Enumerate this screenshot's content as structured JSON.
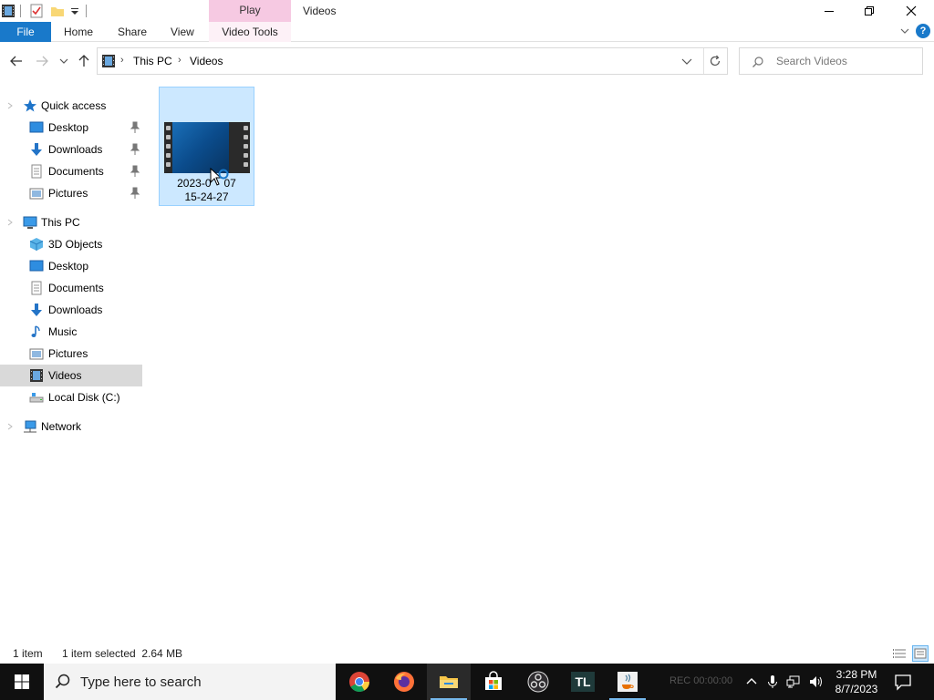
{
  "window": {
    "title": "Videos",
    "context_tab_group": "Play"
  },
  "ribbon": {
    "tabs": [
      {
        "label": "File"
      },
      {
        "label": "Home"
      },
      {
        "label": "Share"
      },
      {
        "label": "View"
      },
      {
        "label": "Video Tools"
      }
    ],
    "help_label": "?"
  },
  "address": {
    "crumbs": [
      "This PC",
      "Videos"
    ],
    "search_placeholder": "Search Videos"
  },
  "sidebar": {
    "quick_access": {
      "label": "Quick access",
      "items": [
        {
          "label": "Desktop"
        },
        {
          "label": "Downloads"
        },
        {
          "label": "Documents"
        },
        {
          "label": "Pictures"
        }
      ]
    },
    "this_pc": {
      "label": "This PC",
      "items": [
        {
          "label": "3D Objects"
        },
        {
          "label": "Desktop"
        },
        {
          "label": "Documents"
        },
        {
          "label": "Downloads"
        },
        {
          "label": "Music"
        },
        {
          "label": "Pictures"
        },
        {
          "label": "Videos"
        },
        {
          "label": "Local Disk (C:)"
        }
      ]
    },
    "network": {
      "label": "Network"
    }
  },
  "content": {
    "file": {
      "name_line1": "2023-0",
      "name_line1_end": "07",
      "name_line2": "15-24-27"
    }
  },
  "status": {
    "item_count": "1 item",
    "selection": "1 item selected  2.64 MB"
  },
  "taskbar": {
    "search_placeholder": "Type here to search",
    "rec_text": "REC 00:00:00",
    "time": "3:28 PM",
    "date": "8/7/2023"
  },
  "colors": {
    "accent": "#1979ca",
    "selection_bg": "#cce8ff",
    "context_tab": "#f6c9e2",
    "taskbar": "#101010"
  }
}
